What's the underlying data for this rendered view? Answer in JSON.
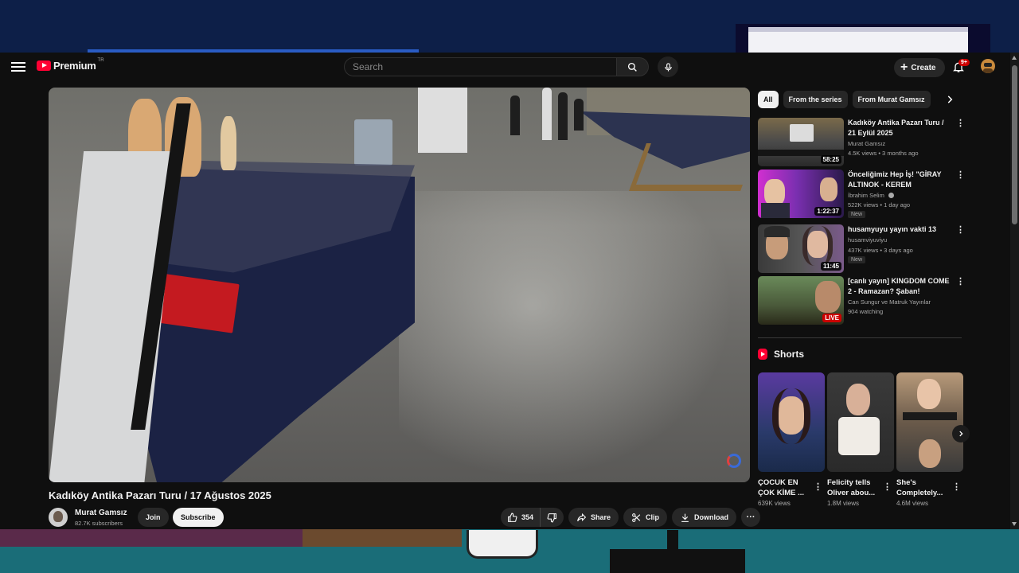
{
  "app": {
    "logo_text": "Premium",
    "logo_country": "TR",
    "brand_color": "#ff0033"
  },
  "header": {
    "search_placeholder": "Search",
    "create_label": "Create",
    "notification_badge": "9+"
  },
  "video": {
    "title": "Kadıköy Antika Pazarı Turu / 17 Ağustos 2025",
    "channel_name": "Murat Gamsız",
    "channel_subs": "82.7K subscribers",
    "join_label": "Join",
    "subscribe_label": "Subscribe",
    "like_count": "354",
    "share_label": "Share",
    "clip_label": "Clip",
    "download_label": "Download"
  },
  "filter_chips": [
    {
      "label": "All",
      "active": true
    },
    {
      "label": "From the series",
      "active": false
    },
    {
      "label": "From Murat Gamsız",
      "active": false
    }
  ],
  "recommendations": [
    {
      "title": "Kadıköy Antika Pazarı Turu / 21 Eylül 2025",
      "channel": "Murat Gamsız",
      "meta": "4.5K views • 3 months ago",
      "duration": "58:25"
    },
    {
      "title": "Önceliğimiz Hep İş! \"GİRAY ALTINOK - KEREM ÖZDOĞAN\" ...",
      "channel": "İbrahim Selim",
      "meta": "522K views • 1 day ago",
      "duration": "1:22:37",
      "badge": "New"
    },
    {
      "title": "husamyuyu yayın vakti 13",
      "channel": "husamviyuviyu",
      "meta": "437K views • 3 days ago",
      "duration": "11:45",
      "badge": "New"
    },
    {
      "title": "[canlı yayın] KINGDOM COME 2 - Ramazan? Şaban!",
      "channel": "Can Sungur ve Matruk Yayınlar",
      "meta": "904 watching",
      "live_label": "LIVE"
    }
  ],
  "shorts": {
    "header": "Shorts",
    "items": [
      {
        "title": "ÇOCUK EN ÇOK KİME ...",
        "views": "639K views"
      },
      {
        "title": "Felicity tells Oliver abou...",
        "views": "1.8M views"
      },
      {
        "title": "She's Completely...",
        "views": "4.6M views"
      }
    ]
  }
}
